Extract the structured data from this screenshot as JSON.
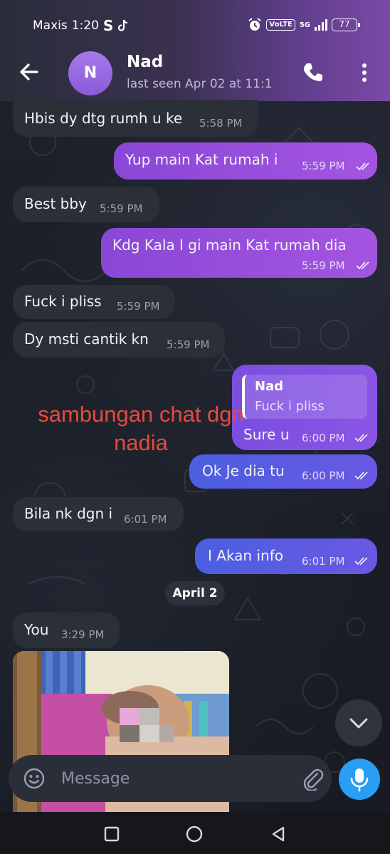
{
  "status_bar": {
    "carrier": "Maxis",
    "time": "1:20",
    "s_glyph": "S",
    "volte": "VoLTE",
    "network": "5G",
    "battery": "77"
  },
  "header": {
    "avatar_initial": "N",
    "contact_name": "Nad",
    "last_seen": "last seen Apr 02 at 11:1"
  },
  "messages": [
    {
      "dir": "in",
      "text": "Hbis dy dtg rumh u ke",
      "time": "5:58 PM"
    },
    {
      "dir": "out",
      "text": "Yup main Kat rumah i",
      "time": "5:59 PM"
    },
    {
      "dir": "in",
      "text": "Best bby",
      "time": "5:59 PM"
    },
    {
      "dir": "out",
      "text": "Kdg Kala I gi main Kat rumah dia",
      "time": "5:59 PM"
    },
    {
      "dir": "in",
      "text": "Fuck i pliss",
      "time": "5:59 PM"
    },
    {
      "dir": "in",
      "text": "Dy msti cantik kn",
      "time": "5:59 PM"
    },
    {
      "dir": "out",
      "text": "Sure u",
      "time": "6:00 PM",
      "reply_to": {
        "name": "Nad",
        "text": "Fuck i pliss"
      }
    },
    {
      "dir": "out",
      "text": "Ok Je dia tu",
      "time": "6:00 PM"
    },
    {
      "dir": "in",
      "text": "Bila nk dgn i",
      "time": "6:01 PM"
    },
    {
      "dir": "out",
      "text": "I Akan info",
      "time": "6:01 PM"
    },
    {
      "dir": "in",
      "text": "You",
      "time": "3:29 PM"
    }
  ],
  "overlay_annotation": {
    "line1": "sambungan chat dgn",
    "line2": "nadia"
  },
  "date_separator": "April 2",
  "composer": {
    "placeholder": "Message"
  },
  "colors": {
    "outgoing_purple": "#9a4fdc",
    "outgoing_blue": "#5a5ce2",
    "incoming": "#2b2f38",
    "accent_mic": "#2a9df4",
    "annotation_red": "#e64a3c"
  },
  "icons": [
    "back-arrow-icon",
    "phone-icon",
    "more-vertical-icon",
    "double-check-icon",
    "chevron-down-icon",
    "emoji-icon",
    "paperclip-icon",
    "mic-icon",
    "square-icon",
    "circle-icon",
    "triangle-back-icon"
  ]
}
